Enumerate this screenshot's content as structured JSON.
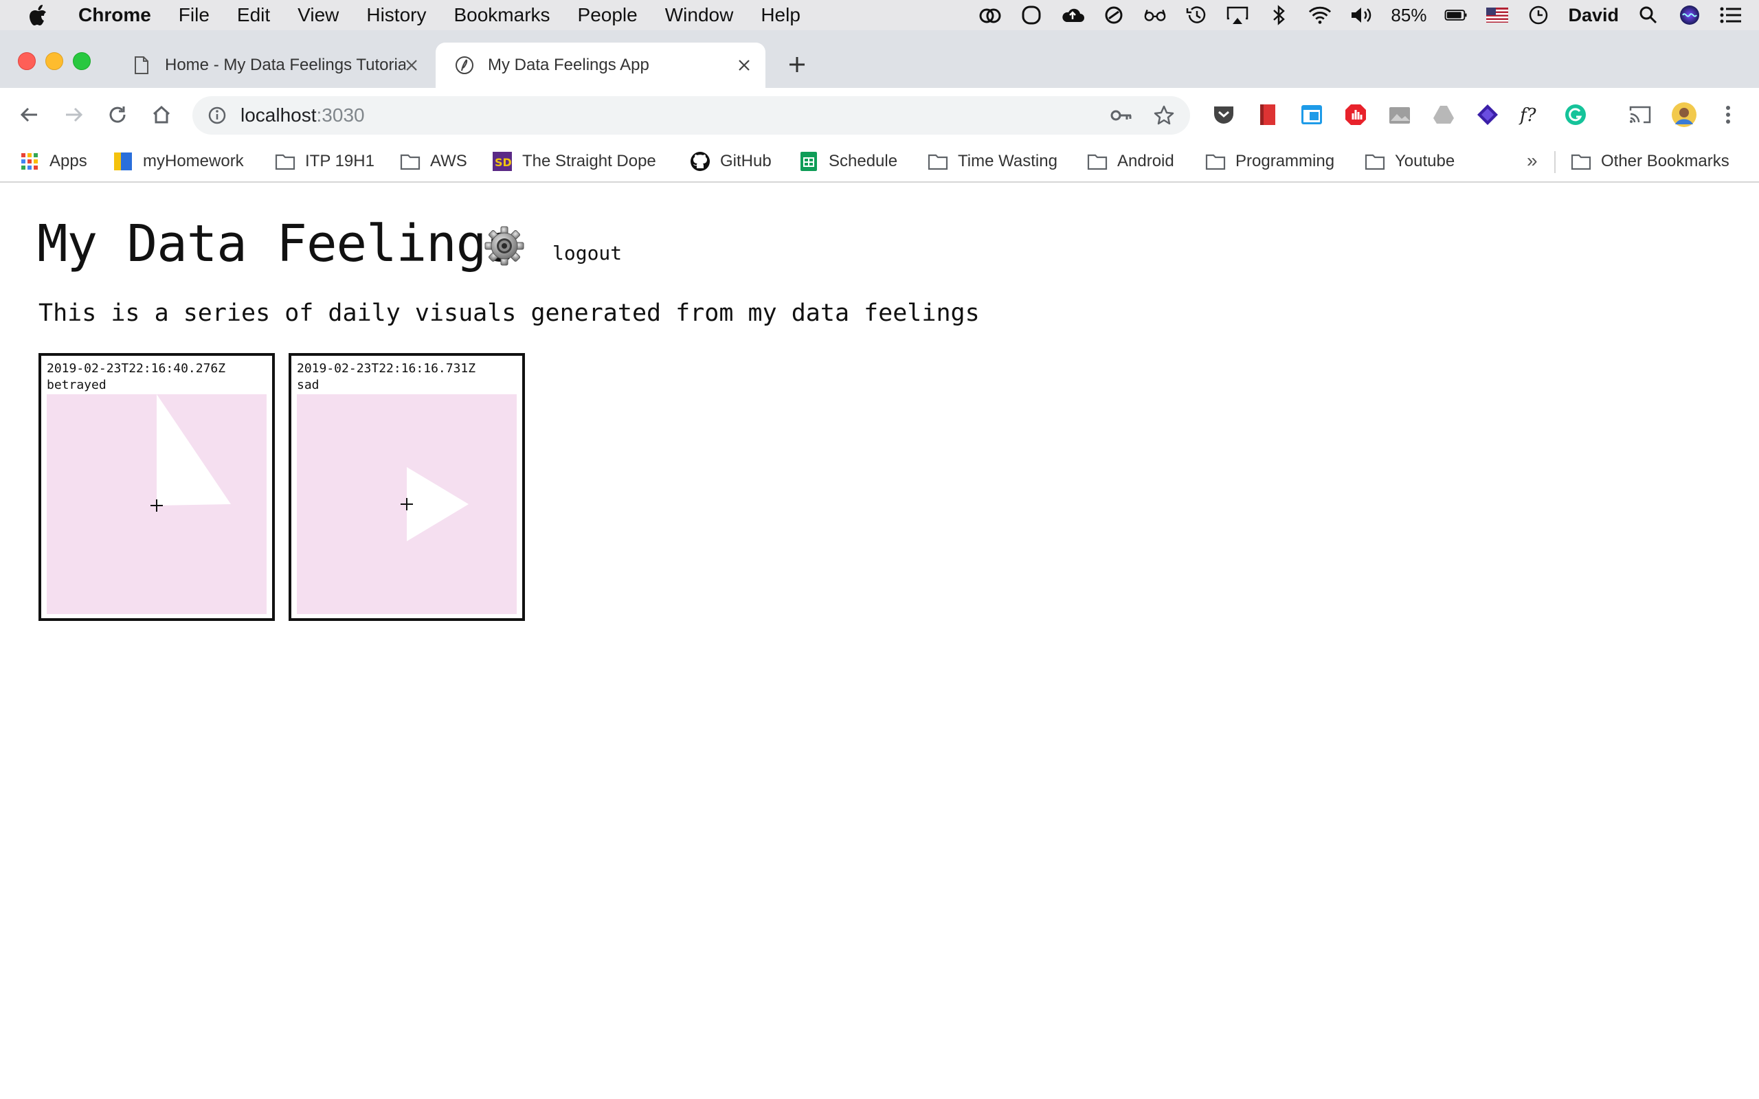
{
  "menubar": {
    "app_name": "Chrome",
    "menus": [
      "File",
      "Edit",
      "View",
      "History",
      "Bookmarks",
      "People",
      "Window",
      "Help"
    ],
    "battery": "85%",
    "user": "David"
  },
  "tabs": [
    {
      "title": "Home - My Data Feelings Tutorial",
      "active": false,
      "icon": "document-icon"
    },
    {
      "title": "My Data Feelings App",
      "active": true,
      "icon": "feather-icon"
    }
  ],
  "omnibox": {
    "host": "localhost",
    "port": ":3030"
  },
  "bookmarks": {
    "items": [
      {
        "label": "Apps",
        "icon": "apps-grid-icon"
      },
      {
        "label": "myHomework",
        "icon": "myhomework-icon"
      },
      {
        "label": "ITP 19H1",
        "icon": "folder-icon"
      },
      {
        "label": "AWS",
        "icon": "folder-icon"
      },
      {
        "label": "The Straight Dope",
        "icon": "straight-dope-icon"
      },
      {
        "label": "GitHub",
        "icon": "github-icon"
      },
      {
        "label": "Schedule",
        "icon": "sheets-icon"
      },
      {
        "label": "Time Wasting",
        "icon": "folder-icon"
      },
      {
        "label": "Android",
        "icon": "folder-icon"
      },
      {
        "label": "Programming",
        "icon": "folder-icon"
      },
      {
        "label": "Youtube",
        "icon": "folder-icon"
      }
    ],
    "more": "»",
    "other": "Other Bookmarks"
  },
  "page": {
    "title": "My Data Feelings",
    "logout": "logout",
    "description": "This is a series of daily visuals generated from my data feelings",
    "visual_bg": "#f5dff0",
    "cards": [
      {
        "timestamp": "2019-02-23T22:16:40.276Z",
        "feeling": "betrayed"
      },
      {
        "timestamp": "2019-02-23T22:16:16.731Z",
        "feeling": "sad"
      }
    ]
  }
}
